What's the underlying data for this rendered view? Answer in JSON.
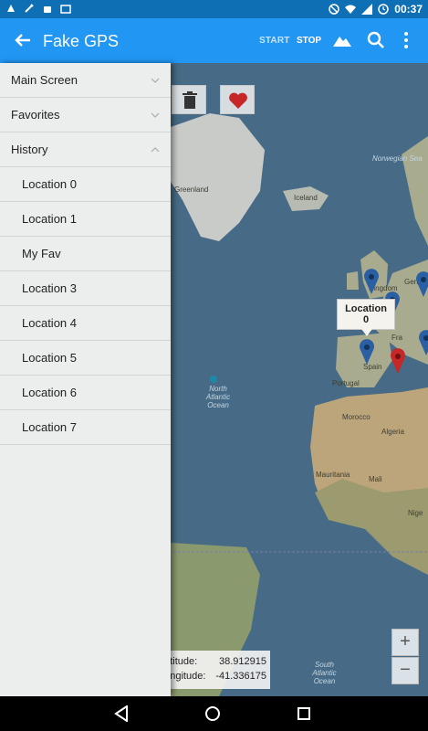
{
  "status_bar": {
    "time": "00:37"
  },
  "app_bar": {
    "title": "Fake GPS",
    "start_label": "START",
    "stop_label": "STOP"
  },
  "drawer": {
    "sections": [
      {
        "label": "Main Screen",
        "expanded": false
      },
      {
        "label": "Favorites",
        "expanded": false
      },
      {
        "label": "History",
        "expanded": true
      }
    ],
    "history_items": [
      "Location 0",
      "Location 1",
      "My Fav",
      "Location 3",
      "Location 4",
      "Location 5",
      "Location 6",
      "Location 7"
    ]
  },
  "map": {
    "labels": {
      "greenland": "Greenland",
      "iceland": "Iceland",
      "norwegian_sea": "Norwegian Sea",
      "kingdom": "Kingdom",
      "german": "German",
      "fra": "Fra",
      "spain": "Spain",
      "portugal": "Portugal",
      "morocco": "Morocco",
      "algeria": "Algeria",
      "mauritania": "Mauritania",
      "mali": "Mali",
      "niger": "Nige",
      "north_atlantic": "North Atlantic Ocean",
      "south_atlantic": "South Atlantic Ocean"
    },
    "callout": "Location 0",
    "zoom_in": "+",
    "zoom_out": "−",
    "coordinates": {
      "latitude_label": "Latitude:",
      "latitude_value": "38.912915",
      "longitude_label": "Longitude:",
      "longitude_value": "-41.336175"
    },
    "colors": {
      "water": "#476b86",
      "land": "#a9ab8e",
      "pin_blue": "#2a5fa3",
      "pin_red": "#c62828"
    }
  }
}
